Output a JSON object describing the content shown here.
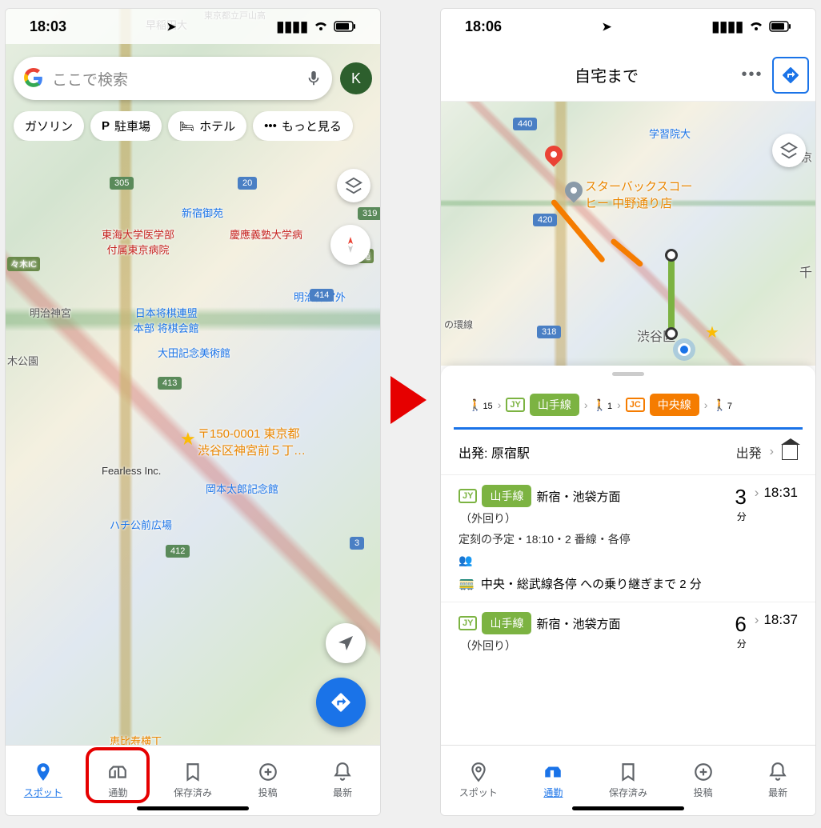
{
  "phone1": {
    "status_time": "18:03",
    "search_placeholder": "ここで検索",
    "avatar_letter": "K",
    "chips": [
      "ガソリン",
      "駐車場",
      "ホテル",
      "もっと見る"
    ],
    "map_labels": {
      "waseda": "早稲田大",
      "todoyama": "東京都立戸山高",
      "yoyogi_park": "々木公園",
      "shinjuku_gyoen": "新宿御苑",
      "tokai": "東海大学医学部\n付属東京病院",
      "keio": "慶應義塾大学病",
      "meiji": "明治神宮",
      "shogi": "日本将棋連盟\n本部 将棋会館",
      "jingu_gaien": "明治神宮外",
      "ota": "大田記念美術館",
      "ki_park": "木公園",
      "address": "〒150-0001 東京都\n渋谷区神宮前５丁…",
      "fearless": "Fearless Inc.",
      "okamoto": "岡本太郎記念館",
      "hachiko": "ハチ公前広場",
      "ebisu": "恵比寿横丁",
      "yoyogi_ic": "々木IC",
      "gaien": "外苑"
    },
    "road_badges": [
      "305",
      "413",
      "412",
      "319",
      "414",
      "3",
      "20"
    ],
    "nav": [
      {
        "label": "スポット",
        "icon": "pin"
      },
      {
        "label": "通勤",
        "icon": "commute"
      },
      {
        "label": "保存済み",
        "icon": "bookmark"
      },
      {
        "label": "投稿",
        "icon": "plus"
      },
      {
        "label": "最新",
        "icon": "bell"
      }
    ]
  },
  "phone2": {
    "status_time": "18:06",
    "dest_title": "自宅まで",
    "map_labels": {
      "gakushuin": "学習院大",
      "starbucks": "スターバックスコー\nヒー 中野通り店",
      "shibuya": "渋谷区",
      "chiyo": "千",
      "kyo": "京",
      "sen": "の環線"
    },
    "road_badges": [
      "440",
      "420",
      "318"
    ],
    "route_seq": {
      "walk1": "15",
      "line1_code": "JY",
      "line1_name": "山手線",
      "walk2": "1",
      "line2_code": "JC",
      "line2_name": "中央線",
      "walk3": "7"
    },
    "depart_label": "出発: 原宿駅",
    "depart_action": "出発",
    "trains": [
      {
        "code": "JY",
        "line": "山手線",
        "direction": "新宿・池袋方面",
        "loop": "（外回り）",
        "detail": "定刻の予定・18:10・2 番線・各停",
        "transfer": "中央・総武線各停 への乗り継ぎまで 2 分",
        "mins": "3",
        "mins_label": "分",
        "arr": "18:31"
      },
      {
        "code": "JY",
        "line": "山手線",
        "direction": "新宿・池袋方面",
        "loop": "（外回り）",
        "mins": "6",
        "mins_label": "分",
        "arr": "18:37"
      }
    ],
    "nav": [
      {
        "label": "スポット",
        "icon": "pin"
      },
      {
        "label": "通勤",
        "icon": "commute"
      },
      {
        "label": "保存済み",
        "icon": "bookmark"
      },
      {
        "label": "投稿",
        "icon": "plus"
      },
      {
        "label": "最新",
        "icon": "bell"
      }
    ]
  }
}
